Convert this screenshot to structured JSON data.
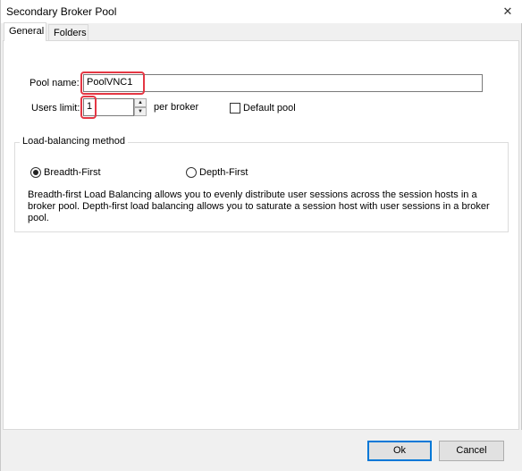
{
  "window": {
    "title": "Secondary Broker Pool",
    "close_glyph": "✕"
  },
  "tabs": [
    {
      "label": "General"
    },
    {
      "label": "Folders"
    }
  ],
  "general": {
    "pool_name_label": "Pool name:",
    "pool_name_value": "PoolVNC1",
    "users_limit_label": "Users limit:",
    "users_limit_value": "1",
    "per_broker_label": "per broker",
    "default_pool_label": "Default pool",
    "default_pool_checked": false
  },
  "load_balancing": {
    "group_title": "Load-balancing method",
    "breadth_first_label": "Breadth-First",
    "depth_first_label": "Depth-First",
    "selected": "Breadth-First",
    "description": "Breadth-first Load Balancing allows you to evenly distribute user sessions across the session hosts in a broker pool. Depth-first load balancing allows you to saturate a session host with user sessions in a broker pool."
  },
  "buttons": {
    "ok": "Ok",
    "cancel": "Cancel"
  },
  "colors": {
    "highlight": "#e43744",
    "default_button_border": "#0078d7"
  }
}
